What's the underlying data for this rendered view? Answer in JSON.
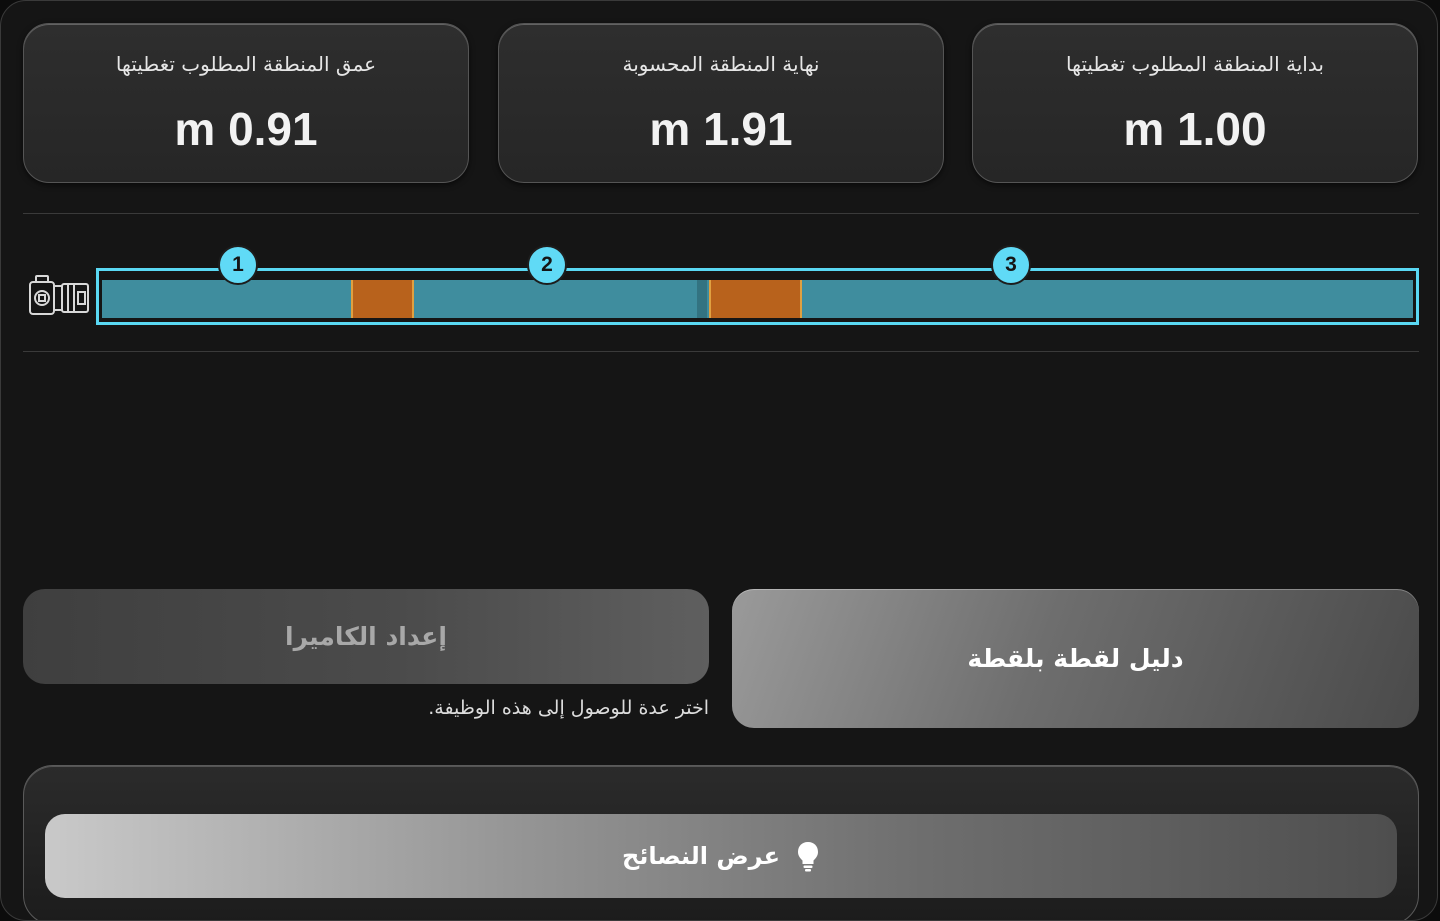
{
  "cards": [
    {
      "label": "بداية المنطقة المطلوب تغطيتها",
      "value": "m 1.00"
    },
    {
      "label": "نهاية المنطقة المحسوبة",
      "value": "m 1.91"
    },
    {
      "label": "عمق المنطقة المطلوب تغطيتها",
      "value": "m 0.91"
    }
  ],
  "markers": [
    "1",
    "2",
    "3"
  ],
  "track": {
    "border_color": "#5ad8f3",
    "fill_color": "#3f8d9e",
    "segment_color": "#b8621c",
    "segments": [
      {
        "start": 0.19,
        "end": 0.238
      },
      {
        "start": 0.463,
        "end": 0.534
      }
    ]
  },
  "icons": {
    "camera": "camera-icon",
    "bulb": "lightbulb-icon"
  },
  "buttons": {
    "camera_setup": "إعداد الكاميرا",
    "camera_hint": "اختر عدة للوصول إلى هذه الوظيفة.",
    "shot_guide": "دليل لقطة بلقطة",
    "show_tips": "عرض النصائح"
  }
}
